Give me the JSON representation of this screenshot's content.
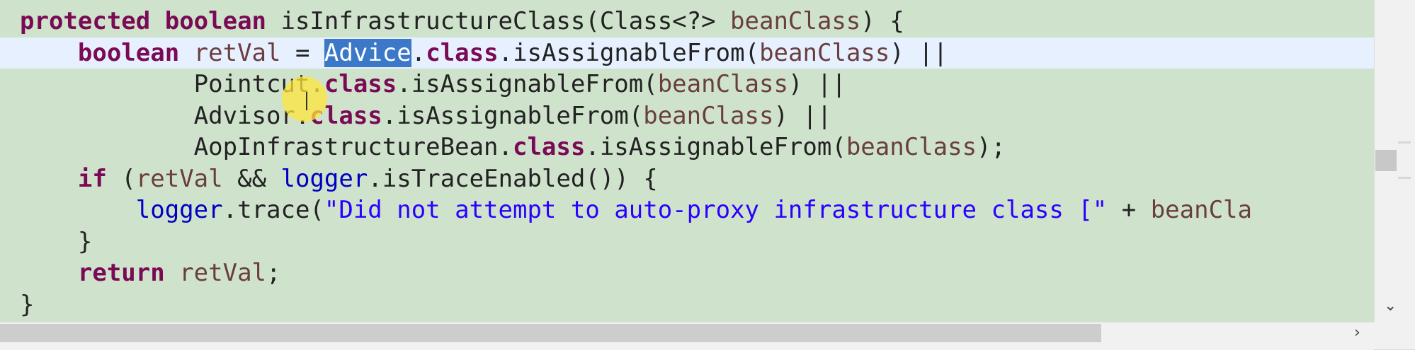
{
  "editor": {
    "lines": [
      {
        "tokens": [
          {
            "t": "protected",
            "c": "kw"
          },
          {
            "t": " ",
            "c": ""
          },
          {
            "t": "boolean",
            "c": "kw"
          },
          {
            "t": " isInfrastructureClass(Class<?> ",
            "c": ""
          },
          {
            "t": "beanClass",
            "c": "param"
          },
          {
            "t": ") {",
            "c": ""
          }
        ]
      },
      {
        "tokens": [
          {
            "t": "    ",
            "c": ""
          },
          {
            "t": "boolean",
            "c": "kw"
          },
          {
            "t": " ",
            "c": ""
          },
          {
            "t": "retVal",
            "c": "param"
          },
          {
            "t": " = ",
            "c": ""
          },
          {
            "t": "Advice",
            "c": "sel"
          },
          {
            "t": ".",
            "c": ""
          },
          {
            "t": "class",
            "c": "kw"
          },
          {
            "t": ".isAssignableFrom(",
            "c": ""
          },
          {
            "t": "beanClass",
            "c": "param"
          },
          {
            "t": ") ||",
            "c": ""
          }
        ]
      },
      {
        "tokens": [
          {
            "t": "            Pointcut.",
            "c": ""
          },
          {
            "t": "class",
            "c": "kw"
          },
          {
            "t": ".isAssignableFrom(",
            "c": ""
          },
          {
            "t": "beanClass",
            "c": "param"
          },
          {
            "t": ") ||",
            "c": ""
          }
        ]
      },
      {
        "tokens": [
          {
            "t": "            Advisor.",
            "c": ""
          },
          {
            "t": "class",
            "c": "kw"
          },
          {
            "t": ".isAssignableFrom(",
            "c": ""
          },
          {
            "t": "beanClass",
            "c": "param"
          },
          {
            "t": ") ||",
            "c": ""
          }
        ]
      },
      {
        "tokens": [
          {
            "t": "            AopInfrastructureBean.",
            "c": ""
          },
          {
            "t": "class",
            "c": "kw"
          },
          {
            "t": ".isAssignableFrom(",
            "c": ""
          },
          {
            "t": "beanClass",
            "c": "param"
          },
          {
            "t": ");",
            "c": ""
          }
        ]
      },
      {
        "tokens": [
          {
            "t": "    ",
            "c": ""
          },
          {
            "t": "if",
            "c": "kw"
          },
          {
            "t": " (",
            "c": ""
          },
          {
            "t": "retVal",
            "c": "param"
          },
          {
            "t": " && ",
            "c": ""
          },
          {
            "t": "logger",
            "c": "field"
          },
          {
            "t": ".isTraceEnabled()) {",
            "c": ""
          }
        ]
      },
      {
        "tokens": [
          {
            "t": "        ",
            "c": ""
          },
          {
            "t": "logger",
            "c": "field"
          },
          {
            "t": ".trace(",
            "c": ""
          },
          {
            "t": "\"Did not attempt to auto-proxy infrastructure class [\"",
            "c": "str"
          },
          {
            "t": " + ",
            "c": ""
          },
          {
            "t": "beanCla",
            "c": "param"
          }
        ]
      },
      {
        "tokens": [
          {
            "t": "    }",
            "c": ""
          }
        ]
      },
      {
        "tokens": [
          {
            "t": "    ",
            "c": ""
          },
          {
            "t": "return",
            "c": "kw"
          },
          {
            "t": " ",
            "c": ""
          },
          {
            "t": "retVal",
            "c": "param"
          },
          {
            "t": ";",
            "c": ""
          }
        ]
      },
      {
        "tokens": [
          {
            "t": "}",
            "c": ""
          }
        ]
      }
    ],
    "current_line": 1
  },
  "icons": {
    "scroll_down": "chevron-down-icon",
    "scroll_right": "chevron-right-icon",
    "cursor": "text-cursor-icon"
  },
  "colors": {
    "background": "#cfe3cc",
    "keyword": "#7a0a55",
    "parameter": "#6a3e3e",
    "field": "#0000c0",
    "string": "#2a00ff",
    "selection": "#3b78c8",
    "current_line": "#e6f0ff"
  }
}
